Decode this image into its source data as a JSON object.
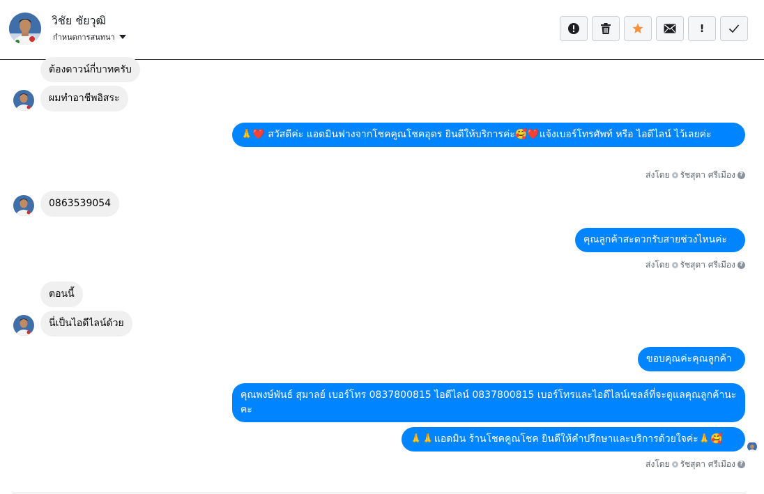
{
  "header": {
    "contact_name": "วิชัย ชัยวุฒิ",
    "conversation_setting": "กำหนดการสนทนา",
    "actions": [
      {
        "name": "report-icon"
      },
      {
        "name": "trash-icon"
      },
      {
        "name": "star-icon",
        "color": "#f7923a"
      },
      {
        "name": "envelope-icon"
      },
      {
        "name": "exclamation-icon",
        "label": "!"
      },
      {
        "name": "check-icon"
      }
    ]
  },
  "colors": {
    "outgoing_bubble": "#0084ff",
    "incoming_bubble": "#f0f0f0",
    "star": "#f7923a"
  },
  "messages": {
    "m1": "ต้องดาวน์กี่บาทครับ",
    "m2": "ผมทำอาชีพอิสระ",
    "m3": "🙏❤️ สวัสดีค่ะ แอดมินฟางจากโชคคูณโชคอุดร ยินดีให้บริการค่ะ🥰❤️แจ้งเบอร์โทรศัพท์ หรือ ไอดีไลน์  ไว้เลยค่ะ",
    "m4": "0863539054",
    "m5": "คุณลูกค้าสะดวกรับสายช่วงไหนค่ะ",
    "m6": "ตอนนี้",
    "m7": "นี่เป็นไอดีไลน์ด้วย",
    "m8": "ขอบคุณค่ะคุณลูกค้า",
    "m9": "คุณพงษ์พันธ์ สุมาลย์      เบอร์โทร 0837800815  ไอดีไลน์ 0837800815   เบอร์โทรและไอดีไลน์เซลล์ที่จะดูแลคุณลูกค้านะคะ",
    "m10": "🙏🙏แอดมิน ร้านโชคคูณโชค ยินดีให้คำปรึกษาและบริการด้วยใจค่ะ🙏🥰"
  },
  "sent_by": {
    "prefix": "ส่งโดย",
    "agent": "รัชสุดา ศรีเมือง",
    "help": "?"
  }
}
